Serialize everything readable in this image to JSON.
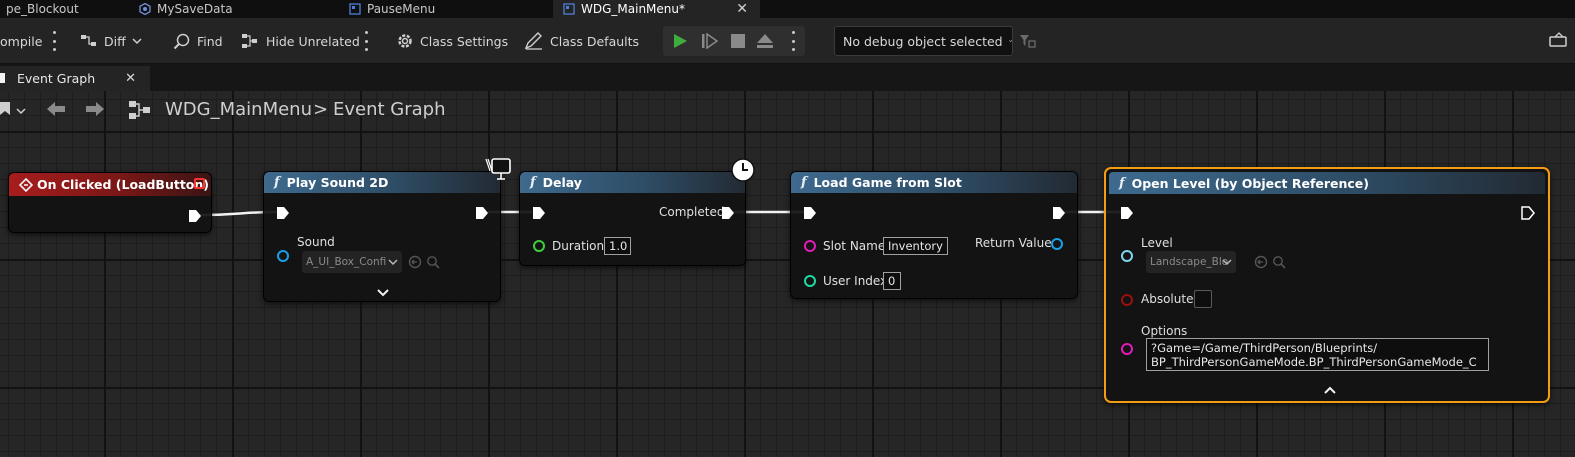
{
  "tabs": [
    {
      "label": "pe_Blockout"
    },
    {
      "label": "MySaveData"
    },
    {
      "label": "PauseMenu"
    },
    {
      "label": "WDG_MainMenu*"
    }
  ],
  "toolbar": {
    "compile_label": "ompile",
    "diff_label": "Diff",
    "find_label": "Find",
    "hide_unrelated_label": "Hide Unrelated",
    "class_settings_label": "Class Settings",
    "class_defaults_label": "Class Defaults",
    "debug_selector": "No debug object selected"
  },
  "graph_tab": {
    "label": "Event Graph"
  },
  "breadcrumb": {
    "root": "WDG_MainMenu",
    "separator": ">",
    "current": "Event Graph"
  },
  "nodes": {
    "on_clicked": {
      "title": "On Clicked (LoadButton)"
    },
    "play_sound": {
      "title": "Play Sound 2D",
      "sound_label": "Sound",
      "sound_value": "A_UI_Box_Confi"
    },
    "delay": {
      "title": "Delay",
      "completed_label": "Completed",
      "duration_label": "Duration",
      "duration_value": "1.0"
    },
    "load_game": {
      "title": "Load Game from Slot",
      "slot_label": "Slot Name",
      "slot_value": "Inventory",
      "user_index_label": "User Index",
      "user_index_value": "0",
      "return_label": "Return Value"
    },
    "open_level": {
      "title": "Open Level (by Object Reference)",
      "level_label": "Level",
      "level_value": "Landscape_Blo",
      "absolute_label": "Absolute",
      "options_label": "Options",
      "options_line1": "?Game=/Game/ThirdPerson/Blueprints/",
      "options_line2": "BP_ThirdPersonGameMode.BP_ThirdPersonGameMode_C"
    }
  },
  "colors": {
    "accent_select": "#f59d12",
    "play_green": "#3fae3f",
    "event_header": "#a81d1d",
    "function_header": "#3e6a8e",
    "pin_object": "#1a9fe6",
    "pin_float": "#3ecf3e",
    "pin_string": "#e21bb8",
    "pin_int": "#1fd9a3",
    "pin_bool": "#9a1010",
    "pin_softobject": "#7fd4ef"
  },
  "icons": [
    "blueprint-tab-icon",
    "save-data-icon",
    "widget-tab-icon",
    "find-icon",
    "hide-unrelated-icon",
    "class-settings-gear-icon",
    "class-defaults-icon",
    "play-icon",
    "step-icon",
    "stop-icon",
    "eject-icon",
    "clock-icon",
    "monitor-icon",
    "back-arrow-icon",
    "forward-arrow-icon",
    "graph-icon",
    "dropdown-chevron-icon"
  ]
}
